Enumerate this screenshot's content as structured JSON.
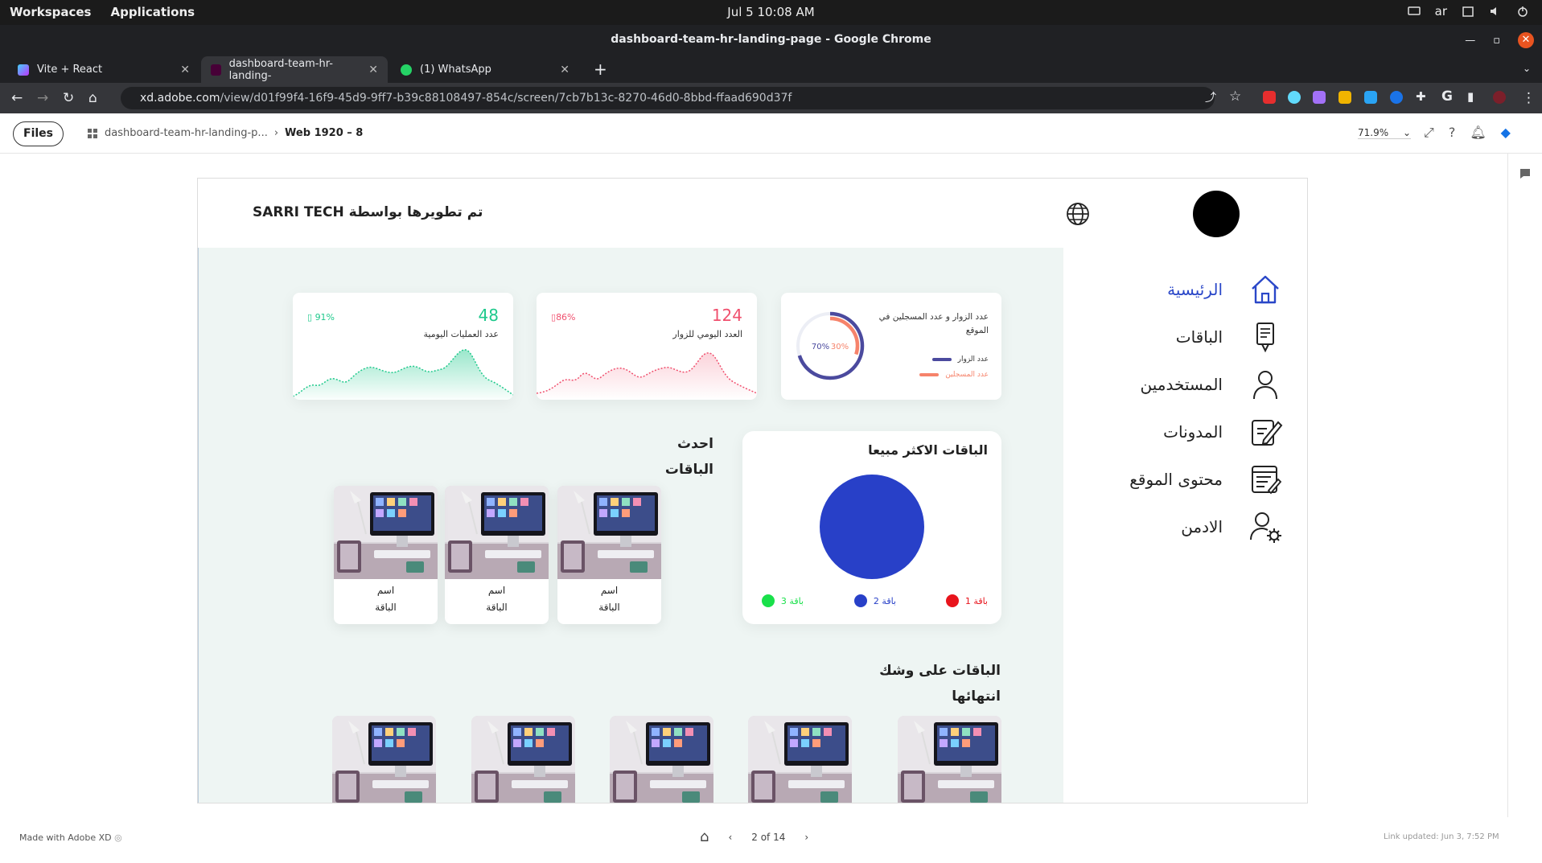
{
  "os": {
    "workspaces": "Workspaces",
    "applications": "Applications",
    "clock": "Jul 5  10:08 AM",
    "lang": "ar"
  },
  "window": {
    "title": "dashboard-team-hr-landing-page - Google Chrome"
  },
  "tabs": [
    {
      "label": "Vite + React"
    },
    {
      "label": "dashboard-team-hr-landing-"
    },
    {
      "label": "(1) WhatsApp"
    }
  ],
  "address": {
    "host": "xd.adobe.com",
    "path": "/view/d01f99f4-16f9-45d9-9ff7-b39c88108497-854c/screen/7cb7b13c-8270-46d0-8bbd-ffaad690d37f"
  },
  "xd": {
    "files_label": "Files",
    "breadcrumb_doc": "dashboard-team-hr-landing-p...",
    "breadcrumb_screen": "Web 1920 – 8",
    "zoom": "71.9%"
  },
  "artboard": {
    "header_title": "تم تطويرها بواسطة SARRI TECH",
    "nav": [
      {
        "label": "الرئيسية",
        "icon": "home-icon"
      },
      {
        "label": "الباقات",
        "icon": "package-icon"
      },
      {
        "label": "المستخدمين",
        "icon": "user-icon"
      },
      {
        "label": "المدونات",
        "icon": "edit-icon"
      },
      {
        "label": "محتوى الموقع",
        "icon": "content-icon"
      },
      {
        "label": "الادمن",
        "icon": "admin-gear-icon"
      }
    ],
    "stats": {
      "visitors_donut": {
        "title": "عدد الزوار و عدد المسجلين في الموقع",
        "pct_visitors": "70%",
        "pct_registered": "30%",
        "visitors_fraction": 0.7,
        "registered_fraction": 0.3,
        "legend_visitors": "عدد الزوار",
        "legend_registered": "عدد المسجلين"
      },
      "daily_visitors": {
        "value": "124",
        "label": "العدد اليومي للزوار",
        "pct": "86%"
      },
      "daily_ops": {
        "value": "48",
        "label": "عدد العمليات اليومية",
        "pct": "91%"
      }
    },
    "best_sellers": {
      "title": "الباقات الاكثر مبيعا",
      "legend": [
        "باقة 1",
        "باقة 2",
        "باقة 3"
      ]
    },
    "latest": {
      "title_line1": "احدث",
      "title_line2": "الباقات",
      "item_line1": "اسم",
      "item_line2": "الباقة"
    },
    "ending": {
      "title_line1": "الباقات على وشك",
      "title_line2": "انتهائها"
    }
  },
  "footer": {
    "made_with": "Made with Adobe XD",
    "pager": "2 of 14",
    "link_updated": "Link updated: Jun 3, 7:52 PM"
  },
  "colors": {
    "accent_blue": "#2a47c8",
    "green": "#1fc98c",
    "red": "#f0506e",
    "donut_purple": "#4b4a9e",
    "donut_orange": "#f6836b"
  }
}
